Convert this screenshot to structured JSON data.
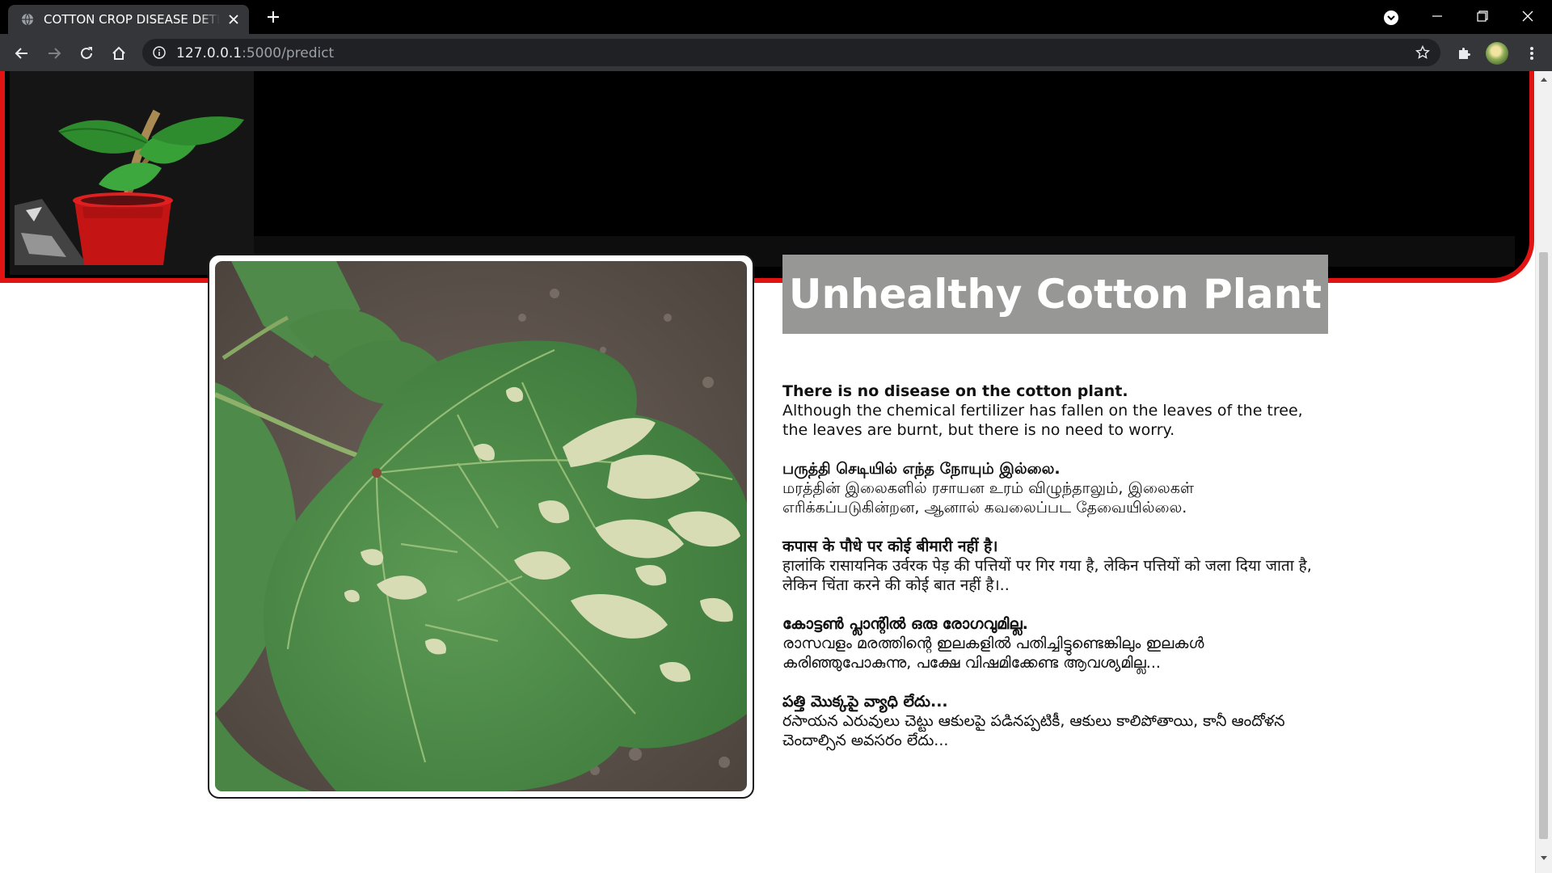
{
  "browser": {
    "tab_title": "COTTON CROP DISEASE DETECTION",
    "url_host": "127.0.0.1",
    "url_rest": ":5000/predict"
  },
  "result": {
    "title": "Unhealthy Cotton Plant"
  },
  "descriptions": [
    {
      "heading": "There is no disease on the cotton plant.",
      "body": "Although the chemical fertilizer has fallen on the leaves of the tree, the leaves are burnt, but there is no need to worry."
    },
    {
      "heading": "பருத்தி செடியில் எந்த நோயும் இல்லை.",
      "body": "மரத்தின் இலைகளில் ரசாயன உரம் விழுந்தாலும், இலைகள் எரிக்கப்படுகின்றன, ஆனால் கவலைப்பட தேவையில்லை."
    },
    {
      "heading": "कपास के पौधे पर कोई बीमारी नहीं है।",
      "body": "हालांकि रासायनिक उर्वरक पेड़ की पत्तियों पर गिर गया है, लेकिन पत्तियों को जला दिया जाता है, लेकिन चिंता करने की कोई बात नहीं है।.."
    },
    {
      "heading": "കോട്ടൺ പ്ലാന്റിൽ ഒരു രോഗവുമില്ല.",
      "body": "രാസവളം മരത്തിന്റെ ഇലകളിൽ പതിച്ചിട്ടുണ്ടെങ്കിലും ഇലകൾ കരിഞ്ഞുപോകുന്നു, പക്ഷേ വിഷമിക്കേണ്ട ആവശ്യമില്ല..."
    },
    {
      "heading": "పత్తి మొక్కపై వ్యాధి లేదు...",
      "body": "రసాయన ఎరువులు చెట్టు ఆకులపై పడినప్పటికీ, ఆకులు కాలిపోతాయి, కానీ ఆందోళన చెందాల్సిన అవసరం లేదు..."
    }
  ],
  "colors": {
    "header_border": "#e11313",
    "result_box": "#979895",
    "leaf_green": "#4f8a4a"
  },
  "icons": [
    "globe-icon",
    "close-icon",
    "plus-icon",
    "tab-search-icon",
    "minimize-icon",
    "restore-icon",
    "window-close-icon",
    "back-icon",
    "forward-icon",
    "reload-icon",
    "home-icon",
    "info-icon",
    "star-icon",
    "puzzle-icon",
    "menu-icon"
  ]
}
